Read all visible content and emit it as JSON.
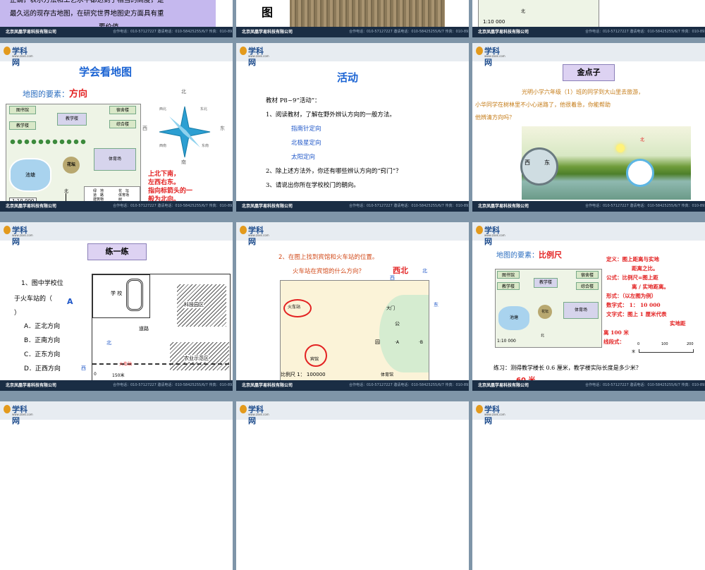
{
  "footer": {
    "company": "北京凤凰学易科技有限公司",
    "contact": "合作电话：010-57127227  邀请电话：010-58425255/6/7  传真：010-89313898"
  },
  "logo": {
    "name": "学科网",
    "url": "www.zxxk.com"
  },
  "r0": {
    "intro": [
      "正确，表示方法和工艺水平都达到了相当的高度，是",
      "最久远的现存古地图，在研究世界地图史方面具有重",
      "要价值。"
    ],
    "tu": "图",
    "scale": "1:10 000",
    "north": "北"
  },
  "s1": {
    "title": "学会看地图",
    "elem_label": "地图的要素：",
    "elem": "方向",
    "buildings": {
      "library": "图书馆",
      "dorm": "宿舍楼",
      "teach": "教学楼",
      "general": "综合楼",
      "flower": "花坛",
      "gym": "体育场",
      "pool": "池塘"
    },
    "legend": [
      "绿　地",
      "道　路",
      "建筑物",
      "水　池",
      "花　坛",
      "体育场",
      "树"
    ],
    "scale": "1:10 000",
    "north": "北",
    "compass": {
      "n": "北",
      "s": "南",
      "e": "东",
      "w": "西",
      "ne": "东北",
      "nw": "西北",
      "se": "东南",
      "sw": "西南"
    },
    "rule": [
      "上北下南，",
      "左西右东。",
      "指向标箭头的一",
      "般为北向。"
    ]
  },
  "s2": {
    "title": "活动",
    "lines": [
      "教材 P8~9“活动”：",
      "1、阅读教材，了解在野外辨认方向的一般方法。",
      "指南针定向",
      "北极星定向",
      "太阳定向",
      "2、除上述方法外，你还有哪些辨认方向的“窍门”？",
      "3、请说出你所在学校校门的朝向。"
    ]
  },
  "s3": {
    "title": "金点子",
    "text": [
      "光明小学六年级（1）班的同学到大山里去旅游，",
      "小华同学在树林里不小心迷路了，他很着急，你能帮助",
      "他辨清方向吗？"
    ],
    "n": "北",
    "w": "西",
    "e": "东"
  },
  "s4": {
    "title": "练一练",
    "q": [
      "1、图中学校位",
      "于火车站的（",
      "）"
    ],
    "answer": "A",
    "options": [
      "A．正北方向",
      "B．正南方向",
      "C．正东方向",
      "D．正西方向"
    ],
    "map": {
      "school": "学\n校",
      "road": "道路",
      "tech": "科技园区",
      "farm": "农业示范区",
      "station": "火车站",
      "scale": "150米",
      "zero": "0",
      "n": "北",
      "w": "西"
    }
  },
  "s5": {
    "q": [
      "2、在图上找到宾馆和火车站的位置。",
      "火车站在宾馆的什么方向？"
    ],
    "ans": "西北",
    "labels": {
      "station": "火车站",
      "hotel": "宾馆",
      "gate": "大门",
      "park": "公",
      "yuan": "园",
      "gym": "体育馆",
      "a": "·A",
      "b": "·B",
      "n": "北",
      "w": "西",
      "e": "东"
    },
    "scale": "比例尺 1：  100000"
  },
  "s6": {
    "elem_label": "地图的要素：",
    "elem": "比例尺",
    "def": [
      "定义：图上距离与实地",
      "距离之比。",
      "公式：比例尺=图上距",
      "离 / 实地距离。",
      "形式：（以左图为例）",
      "数字式： 1：  10 000",
      "文字式：图上 1 厘米代表",
      "实地距",
      "离 100 米",
      "线段式："
    ],
    "ticks": [
      "0",
      "100",
      "200"
    ],
    "unit": "米",
    "practice": "练习：测得教学楼长 0.6 厘米，教学楼实际长度是多少米？",
    "answer": "60 米",
    "buildings": {
      "library": "图书馆",
      "dorm": "宿舍楼",
      "teach": "教学楼",
      "general": "综合楼",
      "flower": "花坛",
      "gym": "体育场",
      "pool": "池塘"
    },
    "scale": "1:10 000",
    "north": "北"
  }
}
